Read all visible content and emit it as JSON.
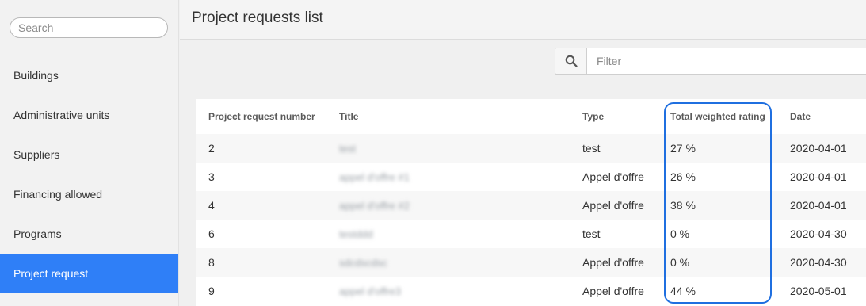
{
  "sidebar": {
    "search_placeholder": "Search",
    "items": [
      {
        "label": "Buildings"
      },
      {
        "label": "Administrative units"
      },
      {
        "label": "Suppliers"
      },
      {
        "label": "Financing allowed"
      },
      {
        "label": "Programs"
      },
      {
        "label": "Project request",
        "active": true
      }
    ]
  },
  "header": {
    "title": "Project requests list"
  },
  "filter": {
    "icon": "search-icon",
    "placeholder": "Filter"
  },
  "table": {
    "columns": [
      "Project request number",
      "Title",
      "Type",
      "Total weighted rating",
      "Date"
    ],
    "rows": [
      {
        "number": "2",
        "title": "test",
        "type": "test",
        "rating": "27 %",
        "date": "2020-04-01"
      },
      {
        "number": "3",
        "title": "appel d'offre #1",
        "type": "Appel d'offre",
        "rating": "26 %",
        "date": "2020-04-01"
      },
      {
        "number": "4",
        "title": "appel d'offre #2",
        "type": "Appel d'offre",
        "rating": "38 %",
        "date": "2020-04-01"
      },
      {
        "number": "6",
        "title": "testddd",
        "type": "test",
        "rating": "0 %",
        "date": "2020-04-30"
      },
      {
        "number": "8",
        "title": "sdcdscdsc",
        "type": "Appel d'offre",
        "rating": "0 %",
        "date": "2020-04-30"
      },
      {
        "number": "9",
        "title": "appel d'offre3",
        "type": "Appel d'offre",
        "rating": "44 %",
        "date": "2020-05-01"
      }
    ]
  },
  "colors": {
    "accent": "#2f7ff7",
    "highlight": "#1f6fe0"
  }
}
